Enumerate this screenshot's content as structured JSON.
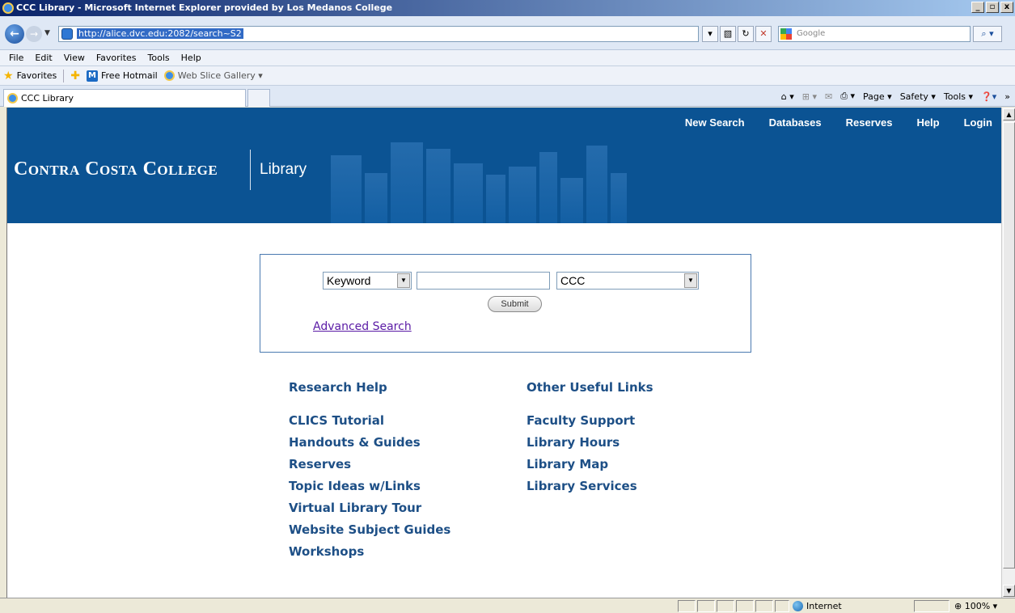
{
  "window": {
    "title": "CCC Library - Microsoft Internet Explorer provided by Los Medanos College",
    "minimize": "_",
    "maximize": "▫",
    "close": "x"
  },
  "address_bar": {
    "url": "http://alice.dvc.edu:2082/search~S2",
    "search_placeholder": "Google"
  },
  "menu": [
    "File",
    "Edit",
    "View",
    "Favorites",
    "Tools",
    "Help"
  ],
  "favorites_bar": {
    "favorites_label": "Favorites",
    "items": [
      "Free Hotmail",
      "Web Slice Gallery ▾"
    ]
  },
  "tab": {
    "title": "CCC Library"
  },
  "command_bar": [
    "Page ▾",
    "Safety ▾",
    "Tools ▾"
  ],
  "site": {
    "nav": [
      "New Search",
      "Databases",
      "Reserves",
      "Help",
      "Login"
    ],
    "brand": "Contra Costa College",
    "brand_sub": "Library",
    "search": {
      "type_value": "Keyword",
      "scope_value": "CCC",
      "submit_label": "Submit",
      "advanced_label": "Advanced Search"
    },
    "research_help": {
      "heading": "Research Help",
      "links": [
        "CLICS Tutorial",
        "Handouts & Guides",
        "Reserves",
        "Topic Ideas w/Links",
        "Virtual Library Tour",
        "Website Subject Guides",
        "Workshops"
      ]
    },
    "other_links": {
      "heading": "Other Useful Links",
      "links": [
        "Faculty Support",
        "Library Hours",
        "Library Map",
        "Library Services"
      ]
    }
  },
  "status_bar": {
    "zone": "Internet",
    "zoom": "100%"
  },
  "colors": {
    "banner": "#0b5393",
    "link": "#1d4f86",
    "visited_link": "#5a1aa5"
  }
}
